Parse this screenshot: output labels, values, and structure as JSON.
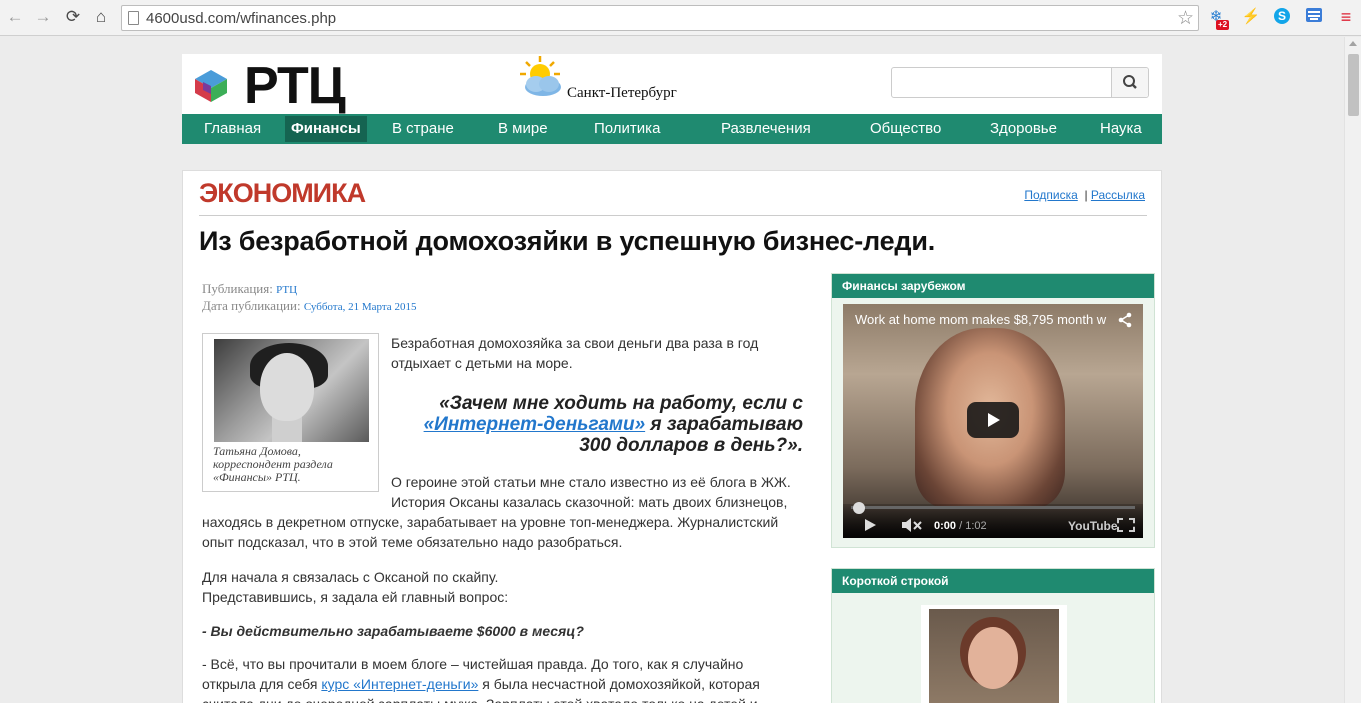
{
  "browser": {
    "url": "4600usd.com/wfinances.php",
    "ext_badge": "+2"
  },
  "site": {
    "logo_text": "РТЦ",
    "city": "Санкт-Петербург",
    "search_placeholder": ""
  },
  "nav": {
    "items": [
      "Главная",
      "Финансы",
      "В стране",
      "В мире",
      "Политика",
      "Развлечения",
      "Общество",
      "Здоровье",
      "Наука"
    ],
    "active_index": 1
  },
  "section": {
    "title": "ЭКОНОМИКА",
    "link_subscribe": "Подписка",
    "separator": "|",
    "link_mailing": "Рассылка"
  },
  "article": {
    "headline": "Из безработной домохозяйки в успешную бизнес-леди.",
    "meta_publication_label": "Публикация:",
    "meta_publication_value": "РТЦ",
    "meta_date_label": "Дата публикации:",
    "meta_date_value": "Суббота, 21 Марта 2015",
    "author_caption": "Татьяна Домова, корреспондент раздела «Финансы» РТЦ.",
    "intro": "Безработная домохозяйка за свои деньги два раза в год отдыхает с детьми на море.",
    "quote_part1": "«Зачем мне ходить на работу, если с",
    "quote_link": "«Интернет-деньгами»",
    "quote_part2": "я зарабатываю 300 долларов в день?».",
    "para1_line1": "О героине этой статьи мне стало известно из её блога в ЖЖ.",
    "para1_line2": "История Оксаны казалась сказочной: мать двоих близнецов,",
    "para1_line3": "находясь в декретном отпуске, зарабатывает на уровне топ-менеджера. Журналистский",
    "para1_line4": "опыт подсказал, что в этой теме обязательно надо разобраться.",
    "para2_line1": "Для начала я связалась с Оксаной по скайпу.",
    "para2_line2": "Представившись, я задала ей главный вопрос:",
    "question": "- Вы действительно зарабатываете $6000 в месяц?",
    "answer_line1": "- Всё, что вы прочитали в моем блоге – чистейшая правда. До того, как я случайно",
    "answer_line2_prefix": "открыла для себя",
    "answer_link": "курс «Интернет-деньги»",
    "answer_line2_suffix": "я была несчастной домохозяйкой, которая",
    "answer_line3": "считала дни до очередной зарплаты мужа. Зарплаты этой хватало только на детей и"
  },
  "sidebar": {
    "widget1_title": "Финансы зарубежом",
    "video_title": "Work at home mom makes $8,795 month w",
    "video_time_current": "0:00",
    "video_time_total": "/ 1:02",
    "video_progress": 0.0,
    "yt_logo": "YouTube",
    "widget2_title": "Короткой строкой"
  },
  "colors": {
    "nav_green": "#1f8a70",
    "nav_active": "#156451",
    "section_red": "#c0392b",
    "link_blue": "#2277cc"
  }
}
